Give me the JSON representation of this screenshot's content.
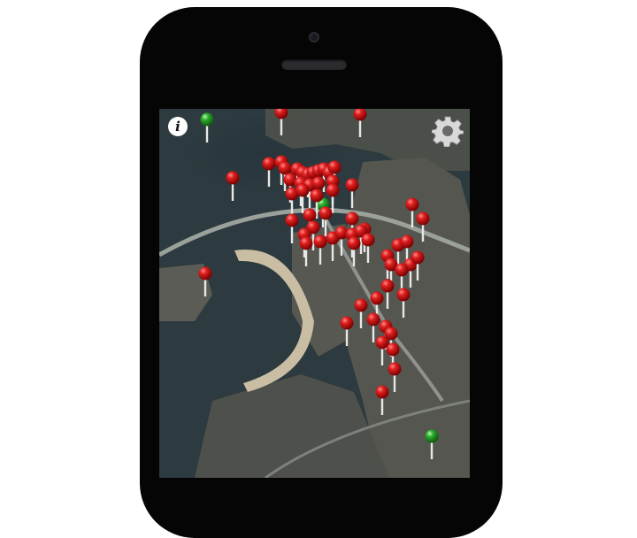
{
  "device": {
    "name": "iPhone 5"
  },
  "map": {
    "view": "satellite",
    "controls": {
      "info_label": "i",
      "settings_icon": "gear-icon",
      "info_icon": "info-icon"
    },
    "marker_colors": {
      "red": "#d81e1e",
      "green": "#2fae2f"
    },
    "markers": [
      {
        "c": "red"
      },
      {
        "c": "red"
      },
      {
        "c": "green"
      },
      {
        "c": "red"
      },
      {
        "c": "red"
      },
      {
        "c": "red"
      },
      {
        "c": "red"
      },
      {
        "c": "red"
      },
      {
        "c": "red"
      },
      {
        "c": "red"
      },
      {
        "c": "red"
      },
      {
        "c": "red"
      },
      {
        "c": "red"
      },
      {
        "c": "red"
      },
      {
        "c": "red"
      },
      {
        "c": "red"
      },
      {
        "c": "red"
      },
      {
        "c": "red"
      },
      {
        "c": "red"
      },
      {
        "c": "green"
      },
      {
        "c": "red"
      },
      {
        "c": "red"
      },
      {
        "c": "red"
      },
      {
        "c": "red"
      },
      {
        "c": "red"
      },
      {
        "c": "red"
      },
      {
        "c": "red"
      },
      {
        "c": "red"
      },
      {
        "c": "red"
      },
      {
        "c": "red"
      },
      {
        "c": "red"
      },
      {
        "c": "red"
      },
      {
        "c": "red"
      },
      {
        "c": "red"
      },
      {
        "c": "red"
      },
      {
        "c": "red"
      },
      {
        "c": "red"
      },
      {
        "c": "red"
      },
      {
        "c": "red"
      },
      {
        "c": "red"
      },
      {
        "c": "red"
      },
      {
        "c": "red"
      },
      {
        "c": "red"
      },
      {
        "c": "red"
      },
      {
        "c": "red"
      },
      {
        "c": "red"
      },
      {
        "c": "red"
      },
      {
        "c": "red"
      },
      {
        "c": "red"
      },
      {
        "c": "red"
      },
      {
        "c": "red"
      },
      {
        "c": "red"
      },
      {
        "c": "red"
      },
      {
        "c": "red"
      },
      {
        "c": "red"
      },
      {
        "c": "red"
      },
      {
        "c": "red"
      },
      {
        "c": "red"
      },
      {
        "c": "red"
      },
      {
        "c": "red"
      },
      {
        "c": "red"
      },
      {
        "c": "red"
      },
      {
        "c": "green"
      },
      {
        "c": "red"
      }
    ]
  }
}
